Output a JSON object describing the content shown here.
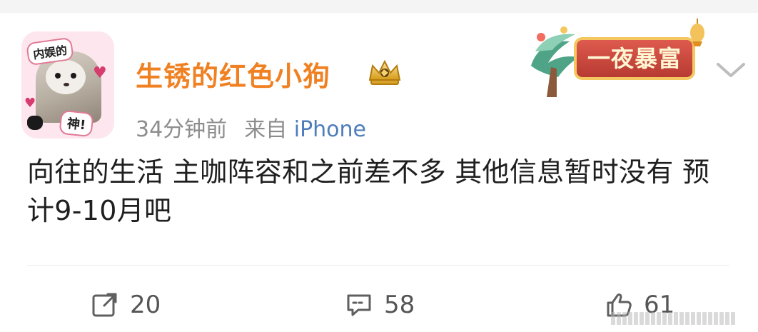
{
  "post": {
    "author": {
      "name": "生锈的红色小狗",
      "avatar_tag_top": "内娱的",
      "avatar_tag_bottom": "神!"
    },
    "meta": {
      "time": "34分钟前",
      "source_prefix": "来自 ",
      "source_link": "iPhone"
    },
    "badge": {
      "text": "一夜暴富"
    },
    "content": "向往的生活 主咖阵容和之前差不多 其他信息暂时没有 预计9-10月吧",
    "actions": {
      "repost_count": "20",
      "comment_count": "58",
      "like_count": "61"
    }
  },
  "colors": {
    "username": "#f08123",
    "meta": "#8d8d8d",
    "source_link": "#4e7dbb",
    "badge_red": "#c63f36",
    "badge_gold": "#f4c760",
    "icon_gray": "#5f5f5f"
  },
  "icons": {
    "crown": "crown-icon",
    "chevron": "chevron-down-icon",
    "repost": "repost-icon",
    "comment": "comment-icon",
    "like": "like-icon"
  }
}
